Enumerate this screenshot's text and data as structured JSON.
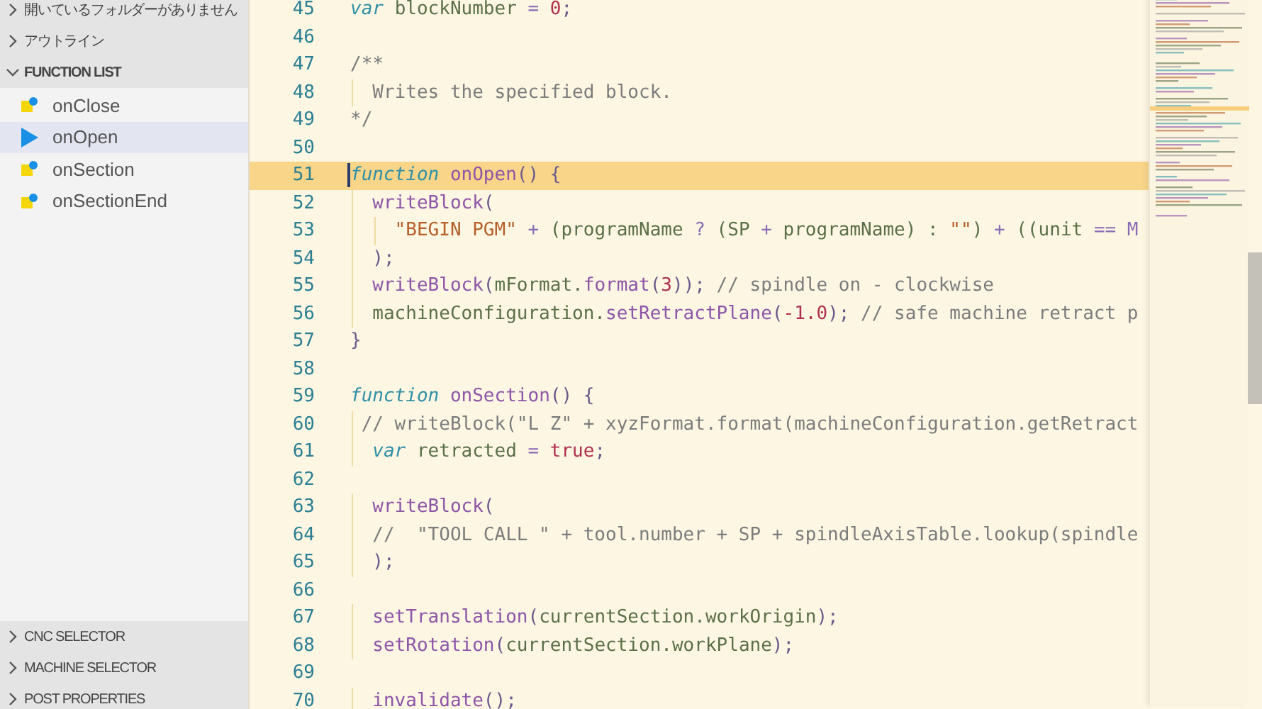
{
  "sidebar": {
    "sections": [
      {
        "title": "開いているフォルダーがありません",
        "expanded": false
      },
      {
        "title": "アウトライン",
        "expanded": false
      },
      {
        "title": "FUNCTION LIST",
        "expanded": true,
        "items": [
          {
            "label": "onClose",
            "selected": false
          },
          {
            "label": "onOpen",
            "selected": true
          },
          {
            "label": "onSection",
            "selected": false
          },
          {
            "label": "onSectionEnd",
            "selected": false
          }
        ]
      },
      {
        "title": "CNC SELECTOR",
        "expanded": false
      },
      {
        "title": "MACHINE SELECTOR",
        "expanded": false
      },
      {
        "title": "POST PROPERTIES",
        "expanded": false
      }
    ]
  },
  "editor": {
    "lines": [
      {
        "number": "45",
        "current": false,
        "tokens": [
          {
            "t": "var ",
            "color": "#2f8fa6",
            "italic": true
          },
          {
            "t": "blockNumber ",
            "color": "#5b7048"
          },
          {
            "t": "= ",
            "color": "#8a6bb5"
          },
          {
            "t": "0",
            "color": "#b0304f"
          },
          {
            "t": ";",
            "color": "#6a5a8c"
          }
        ]
      },
      {
        "number": "46",
        "current": false
      },
      {
        "number": "47",
        "current": false,
        "tokens": [
          {
            "t": "/**",
            "color": "#7c7c7c"
          }
        ]
      },
      {
        "number": "48",
        "current": false,
        "tokens": [
          {
            "t": "  Writes the specified block.",
            "color": "#7c7c7c"
          }
        ]
      },
      {
        "number": "49",
        "current": false,
        "tokens": [
          {
            "t": "*/",
            "color": "#7c7c7c"
          }
        ]
      },
      {
        "number": "50",
        "current": false
      },
      {
        "number": "51",
        "current": true,
        "tokens": [
          {
            "t": "function ",
            "color": "#2f8fa6",
            "italic": true
          },
          {
            "t": "onOpen",
            "color": "#8e55a8"
          },
          {
            "t": "() {",
            "color": "#6a5a8c"
          }
        ]
      },
      {
        "number": "52",
        "current": false,
        "tokens": [
          {
            "t": "  writeBlock",
            "color": "#8e55a8"
          },
          {
            "t": "(",
            "color": "#6a5a8c"
          }
        ]
      },
      {
        "number": "53",
        "current": false,
        "tokens": [
          {
            "t": "    \"BEGIN PGM\" ",
            "color": "#b5602a"
          },
          {
            "t": "+ ",
            "color": "#8a6bb5"
          },
          {
            "t": "(programName ",
            "color": "#5b7048"
          },
          {
            "t": "? ",
            "color": "#8a6bb5"
          },
          {
            "t": "(SP ",
            "color": "#5b7048"
          },
          {
            "t": "+ ",
            "color": "#8a6bb5"
          },
          {
            "t": "programName) : ",
            "color": "#5b7048"
          },
          {
            "t": "\"\"",
            "color": "#b5602a"
          },
          {
            "t": ") ",
            "color": "#5b7048"
          },
          {
            "t": "+ ",
            "color": "#8a6bb5"
          },
          {
            "t": "((unit ",
            "color": "#5b7048"
          },
          {
            "t": "== M",
            "color": "#8a6bb5"
          }
        ]
      },
      {
        "number": "54",
        "current": false,
        "tokens": [
          {
            "t": "  );",
            "color": "#6a5a8c"
          }
        ]
      },
      {
        "number": "55",
        "current": false,
        "tokens": [
          {
            "t": "  writeBlock",
            "color": "#8e55a8"
          },
          {
            "t": "(",
            "color": "#6a5a8c"
          },
          {
            "t": "mFormat.",
            "color": "#5b7048"
          },
          {
            "t": "format",
            "color": "#8e55a8"
          },
          {
            "t": "(",
            "color": "#6a5a8c"
          },
          {
            "t": "3",
            "color": "#b0304f"
          },
          {
            "t": "));",
            "color": "#6a5a8c"
          },
          {
            "t": " // spindle on - clockwise",
            "color": "#7c7c7c"
          }
        ]
      },
      {
        "number": "56",
        "current": false,
        "tokens": [
          {
            "t": "  machineConfiguration.",
            "color": "#5b7048"
          },
          {
            "t": "setRetractPlane",
            "color": "#8e55a8"
          },
          {
            "t": "(",
            "color": "#6a5a8c"
          },
          {
            "t": "-1.0",
            "color": "#b0304f"
          },
          {
            "t": ");",
            "color": "#6a5a8c"
          },
          {
            "t": " // safe machine retract p",
            "color": "#7c7c7c"
          }
        ]
      },
      {
        "number": "57",
        "current": false,
        "tokens": [
          {
            "t": "}",
            "color": "#6a5a8c"
          }
        ]
      },
      {
        "number": "58",
        "current": false
      },
      {
        "number": "59",
        "current": false,
        "tokens": [
          {
            "t": "function ",
            "color": "#2f8fa6",
            "italic": true
          },
          {
            "t": "onSection",
            "color": "#8e55a8"
          },
          {
            "t": "() {",
            "color": "#6a5a8c"
          }
        ]
      },
      {
        "number": "60",
        "current": false,
        "tokens": [
          {
            "t": " // writeBlock(\"L Z\" + xyzFormat.format(machineConfiguration.getRetract",
            "color": "#7c7c7c"
          }
        ]
      },
      {
        "number": "61",
        "current": false,
        "tokens": [
          {
            "t": "  var ",
            "color": "#2f8fa6",
            "italic": true
          },
          {
            "t": "retracted ",
            "color": "#5b7048"
          },
          {
            "t": "= ",
            "color": "#8a6bb5"
          },
          {
            "t": "true",
            "color": "#b0304f"
          },
          {
            "t": ";",
            "color": "#6a5a8c"
          }
        ]
      },
      {
        "number": "62",
        "current": false
      },
      {
        "number": "63",
        "current": false,
        "tokens": [
          {
            "t": "  writeBlock",
            "color": "#8e55a8"
          },
          {
            "t": "(",
            "color": "#6a5a8c"
          }
        ]
      },
      {
        "number": "64",
        "current": false,
        "tokens": [
          {
            "t": "  //  \"TOOL CALL \" + tool.number + SP + spindleAxisTable.lookup(spindle",
            "color": "#7c7c7c"
          }
        ]
      },
      {
        "number": "65",
        "current": false,
        "tokens": [
          {
            "t": "  );",
            "color": "#6a5a8c"
          }
        ]
      },
      {
        "number": "66",
        "current": false
      },
      {
        "number": "67",
        "current": false,
        "tokens": [
          {
            "t": "  setTranslation",
            "color": "#8e55a8"
          },
          {
            "t": "(",
            "color": "#6a5a8c"
          },
          {
            "t": "currentSection.workOrigin",
            "color": "#5b7048"
          },
          {
            "t": ");",
            "color": "#6a5a8c"
          }
        ]
      },
      {
        "number": "68",
        "current": false,
        "tokens": [
          {
            "t": "  setRotation",
            "color": "#8e55a8"
          },
          {
            "t": "(",
            "color": "#6a5a8c"
          },
          {
            "t": "currentSection.workPlane",
            "color": "#5b7048"
          },
          {
            "t": ");",
            "color": "#6a5a8c"
          }
        ]
      },
      {
        "number": "69",
        "current": false
      },
      {
        "number": "70",
        "current": false,
        "tokens": [
          {
            "t": "  invalidate",
            "color": "#8e55a8"
          },
          {
            "t": "();",
            "color": "#6a5a8c"
          }
        ]
      }
    ]
  }
}
